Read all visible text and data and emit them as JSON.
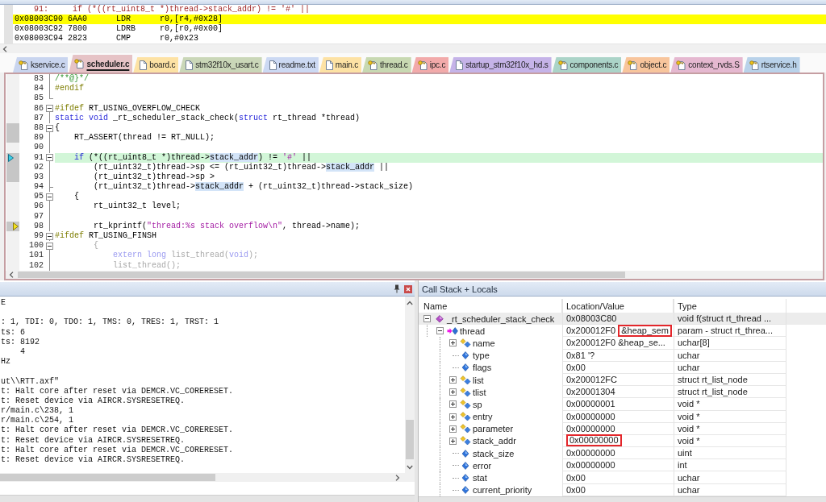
{
  "disassembly": {
    "lines": [
      {
        "kind": "source",
        "current": false,
        "text": "    91:     if (*((rt_uint8_t *)thread->stack_addr) != '#' ||"
      },
      {
        "kind": "instruction",
        "current": true,
        "text": "0x08003C90 6AA0      LDR      r0,[r4,#0x28]"
      },
      {
        "kind": "instruction",
        "current": false,
        "text": "0x08003C92 7800      LDRB     r0,[r0,#0x00]"
      },
      {
        "kind": "instruction",
        "current": false,
        "text": "0x08003C94 2823      CMP      r0,#0x23"
      }
    ]
  },
  "tabs": [
    {
      "label": "kservice.c",
      "kind": "keyed",
      "color": "#c9d5ef",
      "selected": false
    },
    {
      "label": "scheduler.c",
      "kind": "keyed",
      "color": "#e6c3c6",
      "selected": true
    },
    {
      "label": "board.c",
      "kind": "plain",
      "color": "#fde2a4",
      "selected": false
    },
    {
      "label": "stm32f10x_usart.c",
      "kind": "plain",
      "color": "#cad7b8",
      "selected": false
    },
    {
      "label": "readme.txt",
      "kind": "plain",
      "color": "#ccd9f3",
      "selected": false
    },
    {
      "label": "main.c",
      "kind": "plain",
      "color": "#fde2a4",
      "selected": false
    },
    {
      "label": "thread.c",
      "kind": "keyed",
      "color": "#c8d9b2",
      "selected": false
    },
    {
      "label": "ipc.c",
      "kind": "keyed",
      "color": "#f2aaaa",
      "selected": false
    },
    {
      "label": "startup_stm32f10x_hd.s",
      "kind": "plain",
      "color": "#c5b3e8",
      "selected": false
    },
    {
      "label": "components.c",
      "kind": "keyed",
      "color": "#abd4c8",
      "selected": false
    },
    {
      "label": "object.c",
      "kind": "keyed",
      "color": "#f8c59c",
      "selected": false
    },
    {
      "label": "context_rvds.S",
      "kind": "keyed",
      "color": "#e5b8d0",
      "selected": false
    },
    {
      "label": "rtservice.h",
      "kind": "keyed",
      "color": "#b9d2ea",
      "selected": false
    }
  ],
  "editor": {
    "lines": [
      {
        "number": "83",
        "kind": "inner",
        "has_code": false,
        "highlighted": false,
        "cursor": false,
        "execution": false,
        "spans": [
          {
            "kind": "comment",
            "text": "/**@}*/"
          }
        ]
      },
      {
        "number": "84",
        "kind": "inner",
        "has_code": false,
        "highlighted": false,
        "cursor": false,
        "execution": false,
        "spans": [
          {
            "kind": "preprocessor",
            "text": "#endif"
          }
        ]
      },
      {
        "number": "85",
        "kind": "end",
        "has_code": false,
        "highlighted": false,
        "cursor": false,
        "execution": false
      },
      {
        "number": "86",
        "kind": "start",
        "has_code": false,
        "highlighted": false,
        "cursor": false,
        "execution": false,
        "spans": [
          {
            "kind": "preprocessor",
            "text": "#ifdef"
          },
          {
            "kind": "plain",
            "text": " RT_USING_OVERFLOW_CHECK"
          }
        ]
      },
      {
        "number": "87",
        "kind": "inner",
        "has_code": false,
        "highlighted": false,
        "cursor": false,
        "execution": false,
        "spans": [
          {
            "kind": "keyword",
            "text": "static void"
          },
          {
            "kind": "plain",
            "text": " _rt_scheduler_stack_check("
          },
          {
            "kind": "keyword",
            "text": "struct"
          },
          {
            "kind": "plain",
            "text": " rt_thread *thread)"
          }
        ]
      },
      {
        "number": "88",
        "kind": "start",
        "has_code": true,
        "highlighted": false,
        "cursor": false,
        "execution": false,
        "spans": [
          {
            "kind": "plain",
            "text": "{"
          }
        ]
      },
      {
        "number": "89",
        "kind": "inner",
        "has_code": true,
        "highlighted": false,
        "cursor": false,
        "execution": false,
        "spans": [
          {
            "kind": "plain",
            "text": "    RT_ASSERT(thread != RT_NULL);"
          }
        ]
      },
      {
        "number": "90",
        "kind": "inner",
        "has_code": false,
        "highlighted": false,
        "cursor": false,
        "execution": false
      },
      {
        "number": "91",
        "kind": "start",
        "has_code": true,
        "highlighted": true,
        "cursor": true,
        "execution": false,
        "spans": [
          {
            "kind": "keyword",
            "text": "    if"
          },
          {
            "kind": "plain",
            "text": " (*((rt_uint8_t *)thread->"
          },
          {
            "kind": "match",
            "text": "stack_addr"
          },
          {
            "kind": "plain",
            "text": ") != "
          },
          {
            "kind": "string",
            "text": "'#'"
          },
          {
            "kind": "plain",
            "text": " ||"
          }
        ]
      },
      {
        "number": "92",
        "kind": "inner",
        "has_code": true,
        "highlighted": false,
        "cursor": false,
        "execution": false,
        "spans": [
          {
            "kind": "plain",
            "text": "        (rt_uint32_t)thread->sp <= (rt_uint32_t)thread->"
          },
          {
            "kind": "match",
            "text": "stack_addr"
          },
          {
            "kind": "plain",
            "text": " ||"
          }
        ]
      },
      {
        "number": "93",
        "kind": "inner",
        "has_code": true,
        "highlighted": false,
        "cursor": false,
        "execution": false,
        "spans": [
          {
            "kind": "plain",
            "text": "        (rt_uint32_t)thread->sp >"
          }
        ]
      },
      {
        "number": "94",
        "kind": "branch",
        "has_code": false,
        "highlighted": false,
        "cursor": false,
        "execution": false,
        "spans": [
          {
            "kind": "plain",
            "text": "        (rt_uint32_t)thread->"
          },
          {
            "kind": "match",
            "text": "stack_addr"
          },
          {
            "kind": "plain",
            "text": " + (rt_uint32_t)thread->stack_size)"
          }
        ]
      },
      {
        "number": "95",
        "kind": "start",
        "has_code": false,
        "highlighted": false,
        "cursor": false,
        "execution": false,
        "spans": [
          {
            "kind": "plain",
            "text": "    {"
          }
        ]
      },
      {
        "number": "96",
        "kind": "inner",
        "has_code": false,
        "highlighted": false,
        "cursor": false,
        "execution": false,
        "spans": [
          {
            "kind": "plain",
            "text": "        rt_uint32_t level;"
          }
        ]
      },
      {
        "number": "97",
        "kind": "inner",
        "has_code": false,
        "highlighted": false,
        "cursor": false,
        "execution": false
      },
      {
        "number": "98",
        "kind": "inner",
        "has_code": true,
        "highlighted": false,
        "cursor": false,
        "execution": true,
        "spans": [
          {
            "kind": "plain",
            "text": "        rt_kprintf("
          },
          {
            "kind": "string",
            "text": "\"thread:%s stack overflow\\n\""
          },
          {
            "kind": "plain",
            "text": ", thread->name);"
          }
        ]
      },
      {
        "number": "99",
        "kind": "start",
        "has_code": false,
        "highlighted": false,
        "cursor": false,
        "execution": false,
        "spans": [
          {
            "kind": "preprocessor",
            "text": "#ifdef"
          },
          {
            "kind": "plain",
            "text": " RT_USING_FINSH"
          }
        ]
      },
      {
        "number": "100",
        "kind": "start",
        "has_code": false,
        "highlighted": false,
        "cursor": false,
        "execution": false,
        "spans": [
          {
            "kind": "inactive",
            "text": "        {"
          }
        ]
      },
      {
        "number": "101",
        "kind": "inner",
        "has_code": false,
        "highlighted": false,
        "cursor": false,
        "execution": false,
        "spans": [
          {
            "kind": "inactivekeyword",
            "text": "            extern long"
          },
          {
            "kind": "inactive",
            "text": " list_thread("
          },
          {
            "kind": "inactivekeyword",
            "text": "void"
          },
          {
            "kind": "inactive",
            "text": ");"
          }
        ]
      },
      {
        "number": "102",
        "kind": "inner",
        "has_code": false,
        "highlighted": false,
        "cursor": false,
        "execution": false,
        "spans": [
          {
            "kind": "inactive",
            "text": "            list_thread();"
          }
        ]
      }
    ]
  },
  "output": {
    "blocks": [
      [
        "E"
      ],
      [
        ": 1, TDI: 0, TDO: 1, TMS: 0, TRES: 1, TRST: 1",
        "ts: 6",
        "ts: 8192",
        "    4",
        "Hz"
      ],
      [
        "ut\\\\RTT.axf\"",
        "t: Halt core after reset via DEMCR.VC_CORERESET.",
        "t: Reset device via AIRCR.SYSRESETREQ.",
        "r/main.c\\238, 1",
        "r/main.c\\254, 1",
        "t: Halt core after reset via DEMCR.VC_CORERESET.",
        "t: Reset device via AIRCR.SYSRESETREQ.",
        "t: Halt core after reset via DEMCR.VC_CORERESET.",
        "t: Reset device via AIRCR.SYSRESETREQ."
      ]
    ]
  },
  "locals": {
    "title": "Call Stack + Locals",
    "columns": [
      "Name",
      "Location/Value",
      "Type"
    ],
    "rows": [
      {
        "name": "_rt_scheduler_stack_check",
        "kind": "function",
        "expanded": true,
        "value": [
          {
            "text": "0x08003C80",
            "boxed": false
          }
        ],
        "type": "void f(struct rt_thread ...",
        "children": [
          {
            "name": "thread",
            "kind": "parameter",
            "expanded": true,
            "value": [
              {
                "text": "0x200012F0",
                "boxed": false
              },
              {
                "text": "&heap_sem",
                "boxed": true
              }
            ],
            "type": "param - struct rt_threa...",
            "children": [
              {
                "name": "name",
                "kind": "member",
                "expanded": false,
                "value": [
                  {
                    "text": "0x200012F0 &heap_se...",
                    "boxed": false
                  }
                ],
                "type": "uchar[8]"
              },
              {
                "name": "type",
                "kind": "variable",
                "value": [
                  {
                    "text": "0x81 '?",
                    "boxed": false
                  }
                ],
                "type": "uchar"
              },
              {
                "name": "flags",
                "kind": "variable",
                "value": [
                  {
                    "text": "0x00",
                    "boxed": false
                  }
                ],
                "type": "uchar"
              },
              {
                "name": "list",
                "kind": "member",
                "expanded": false,
                "value": [
                  {
                    "text": "0x200012FC",
                    "boxed": false
                  }
                ],
                "type": "struct rt_list_node"
              },
              {
                "name": "tlist",
                "kind": "member",
                "expanded": false,
                "value": [
                  {
                    "text": "0x20001304",
                    "boxed": false
                  }
                ],
                "type": "struct rt_list_node"
              },
              {
                "name": "sp",
                "kind": "member",
                "expanded": false,
                "value": [
                  {
                    "text": "0x00000001",
                    "boxed": false
                  }
                ],
                "type": "void *"
              },
              {
                "name": "entry",
                "kind": "member",
                "expanded": false,
                "value": [
                  {
                    "text": "0x00000000",
                    "boxed": false
                  }
                ],
                "type": "void *"
              },
              {
                "name": "parameter",
                "kind": "member",
                "expanded": false,
                "value": [
                  {
                    "text": "0x00000000",
                    "boxed": false
                  }
                ],
                "type": "void *"
              },
              {
                "name": "stack_addr",
                "kind": "member",
                "expanded": false,
                "value": [
                  {
                    "text": "0x00000000",
                    "boxed": true
                  }
                ],
                "type": "void *"
              },
              {
                "name": "stack_size",
                "kind": "variable",
                "value": [
                  {
                    "text": "0x00000000",
                    "boxed": false
                  }
                ],
                "type": "uint"
              },
              {
                "name": "error",
                "kind": "variable",
                "value": [
                  {
                    "text": "0x00000000",
                    "boxed": false
                  }
                ],
                "type": "int"
              },
              {
                "name": "stat",
                "kind": "variable",
                "value": [
                  {
                    "text": "0x00",
                    "boxed": false
                  }
                ],
                "type": "uchar"
              },
              {
                "name": "current_priority",
                "kind": "variable",
                "value": [
                  {
                    "text": "0x00",
                    "boxed": false
                  }
                ],
                "type": "uchar"
              }
            ]
          }
        ]
      }
    ]
  }
}
